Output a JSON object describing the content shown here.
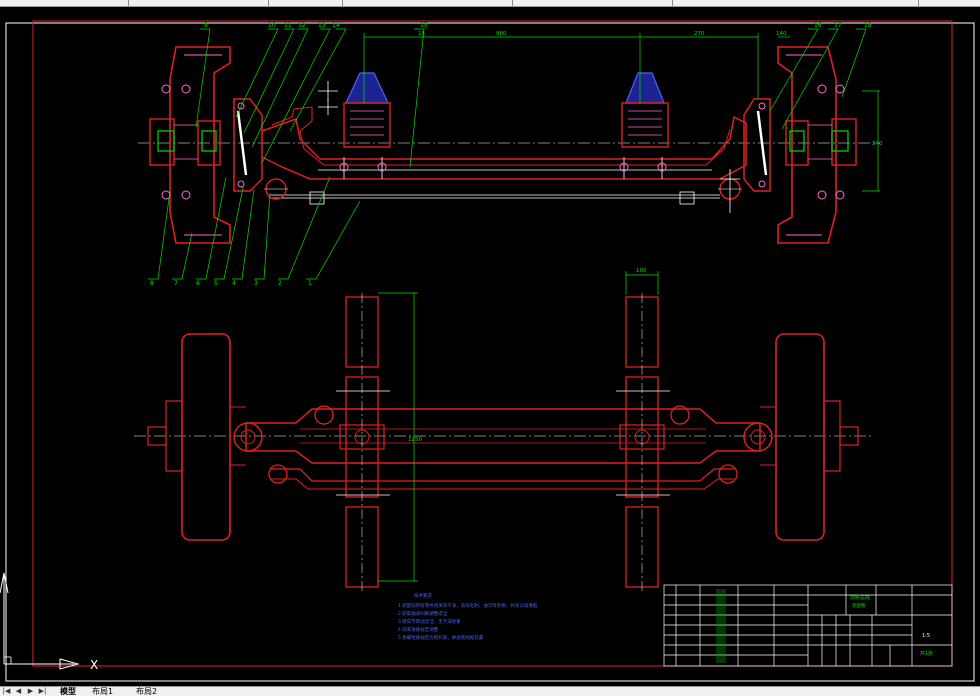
{
  "tabs": {
    "model": "模型",
    "layout1": "布局1",
    "layout2": "布局2",
    "nav": [
      "|◀",
      "◀",
      "▶",
      "▶|"
    ]
  },
  "ucs": {
    "axis_x": "X"
  },
  "drawing": {
    "dims": {
      "d_top_left": "15",
      "d_top_mid": "980",
      "d_top_right": "270",
      "d_right_far": "140",
      "d_side_v": "340",
      "d_plan_small": "100",
      "d_plan_long": "1250"
    },
    "balloons_top": [
      "9",
      "10",
      "11",
      "12",
      "13",
      "14",
      "15",
      "16",
      "17",
      "18"
    ],
    "balloons_bottom": [
      "8",
      "7",
      "6",
      "5",
      "4",
      "3",
      "2",
      "1"
    ]
  },
  "notes": {
    "title": "技术要求",
    "lines": [
      "1.装配前所有零件须清洗干净，去除毛刺、油污等杂物，并涂以润滑脂",
      "2.轮毂轴承间隙调整适当",
      "3.转向节转动灵活，无卡滞现象",
      "4.前束值按规定调整",
      "5.各螺栓按规定力矩拧紧，并加装防松装置"
    ]
  },
  "title_block": {
    "drawing_title": "前桥总成",
    "drawing_subtitle": "装配图",
    "scale": "1:5",
    "sheet": "共1张"
  }
}
